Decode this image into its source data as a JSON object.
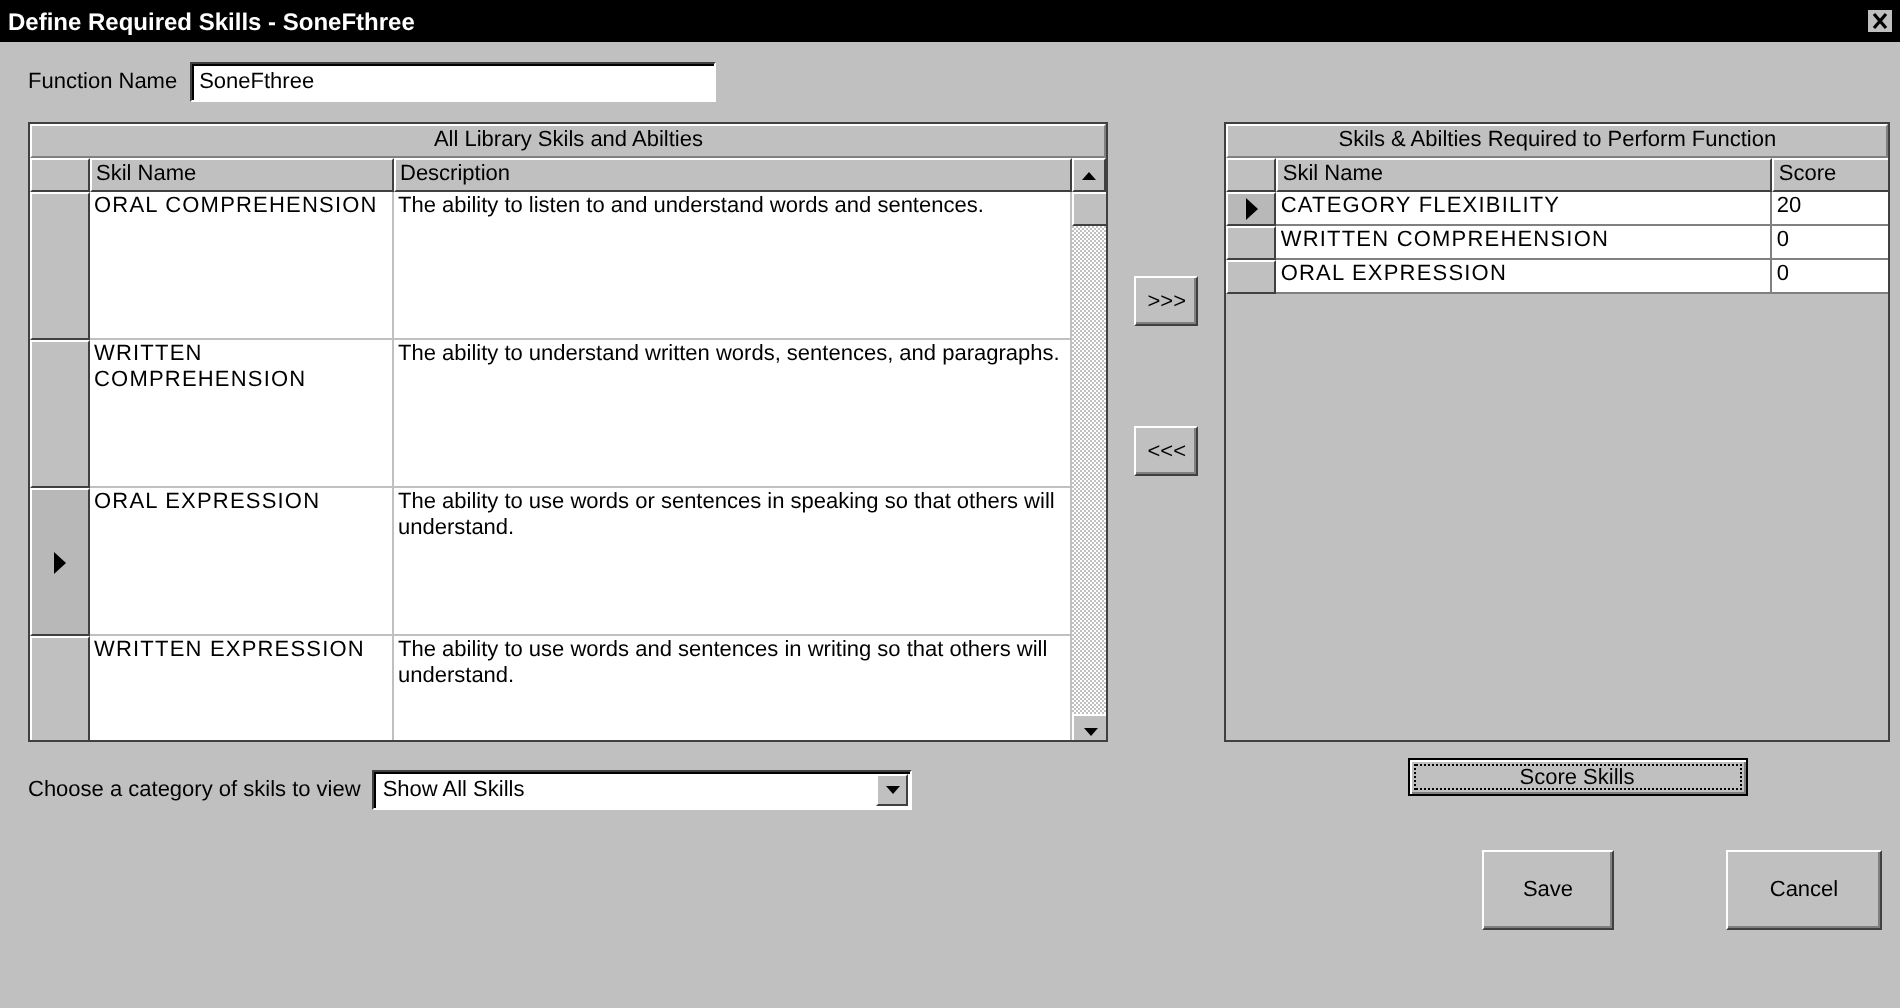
{
  "window": {
    "title": "Define Required Skills - SoneFthree"
  },
  "function_name": {
    "label": "Function Name",
    "value": "SoneFthree"
  },
  "library": {
    "title": "All Library Skils and Abilties",
    "columns": [
      "Skil Name",
      "Description"
    ],
    "rows": [
      {
        "skill": "ORAL COMPREHENSION",
        "description": "The ability to listen to and understand words and sentences.",
        "selected": false
      },
      {
        "skill": "WRITTEN COMPREHENSION",
        "description": "The ability to understand written words, sentences, and paragraphs.",
        "selected": false
      },
      {
        "skill": "ORAL EXPRESSION",
        "description": "The ability to use words or sentences in speaking so that others will understand.",
        "selected": true
      },
      {
        "skill": "WRITTEN EXPRESSION",
        "description": "The ability to use words and sentences in writing so that others will understand.",
        "selected": false
      }
    ]
  },
  "move_buttons": [
    ">>>",
    "<<<"
  ],
  "required": {
    "title": "Skils & Abilties Required to Perform Function",
    "columns": [
      "Skil Name",
      "Score"
    ],
    "rows": [
      {
        "skill": "CATEGORY FLEXIBILITY",
        "score": "20",
        "selected": true
      },
      {
        "skill": "WRITTEN COMPREHENSION",
        "score": "0",
        "selected": false
      },
      {
        "skill": "ORAL EXPRESSION",
        "score": "0",
        "selected": false
      }
    ]
  },
  "category": {
    "label": "Choose a category of skils to view",
    "value": "Show All Skills"
  },
  "score_button": "Score Skills",
  "buttons": [
    "Save",
    "Cancel"
  ]
}
